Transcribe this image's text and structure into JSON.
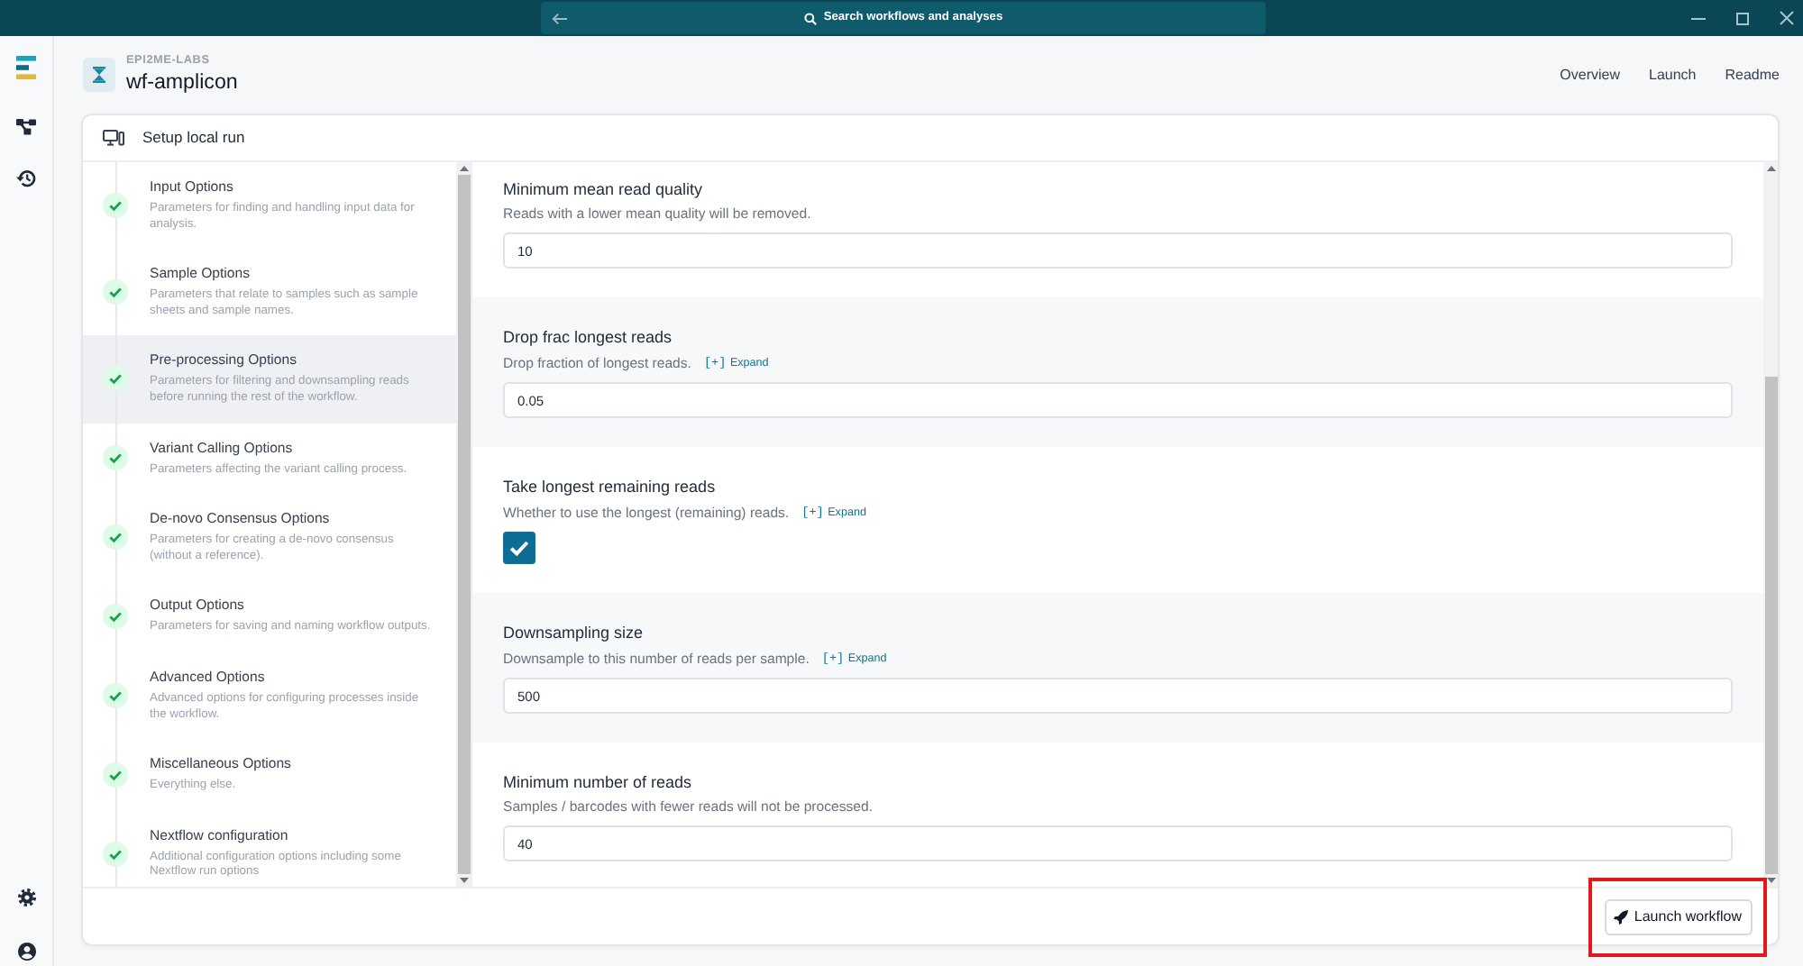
{
  "title_bar": {
    "search": "Search workflows and analyses"
  },
  "header": {
    "organization": "EPI2ME-LABS",
    "workflow": "wf-amplicon",
    "nav": [
      {
        "label": "Overview"
      },
      {
        "label": "Launch"
      },
      {
        "label": "Readme"
      }
    ]
  },
  "panel": {
    "title": "Setup local run",
    "steps": [
      {
        "title": "Input Options",
        "description": "Parameters for finding and handling input data for analysis.",
        "done": true,
        "selected": false
      },
      {
        "title": "Sample Options",
        "description": "Parameters that relate to samples such as sample sheets and sample names.",
        "done": true,
        "selected": false
      },
      {
        "title": "Pre-processing Options",
        "description": "Parameters for filtering and downsampling reads before running the rest of the workflow.",
        "done": true,
        "selected": true
      },
      {
        "title": "Variant Calling Options",
        "description": "Parameters affecting the variant calling process.",
        "done": true,
        "selected": false
      },
      {
        "title": "De-novo Consensus Options",
        "description": "Parameters for creating a de-novo consensus (without a reference).",
        "done": true,
        "selected": false
      },
      {
        "title": "Output Options",
        "description": "Parameters for saving and naming workflow outputs.",
        "done": true,
        "selected": false
      },
      {
        "title": "Advanced Options",
        "description": "Advanced options for configuring processes inside the workflow.",
        "done": true,
        "selected": false
      },
      {
        "title": "Miscellaneous Options",
        "description": "Everything else.",
        "done": true,
        "selected": false
      },
      {
        "title": "Nextflow configuration",
        "description": "Additional configuration options including some Nextflow run options",
        "done": true,
        "selected": false
      }
    ],
    "parameters": [
      {
        "kind": "number",
        "label": "Minimum mean read quality",
        "description": "Reads with a lower mean quality will be removed.",
        "value": "10"
      },
      {
        "kind": "number",
        "label": "Drop frac longest reads",
        "description": "Drop fraction of longest reads.",
        "expand": {
          "marker": "[+]",
          "label": "Expand"
        },
        "value": "0.05"
      },
      {
        "kind": "checkbox",
        "label": "Take longest remaining reads",
        "description": "Whether to use the longest (remaining) reads.",
        "expand": {
          "marker": "[+]",
          "label": "Expand"
        },
        "checked": true
      },
      {
        "kind": "number",
        "label": "Downsampling size",
        "description": "Downsample to this number of reads per sample.",
        "expand": {
          "marker": "[+]",
          "label": "Expand"
        },
        "value": "500"
      },
      {
        "kind": "number",
        "label": "Minimum number of reads",
        "description": "Samples / barcodes with fewer reads will not be processed.",
        "value": "40"
      }
    ],
    "launch_button": {
      "label": "Launch workflow",
      "highlighted": true
    }
  }
}
